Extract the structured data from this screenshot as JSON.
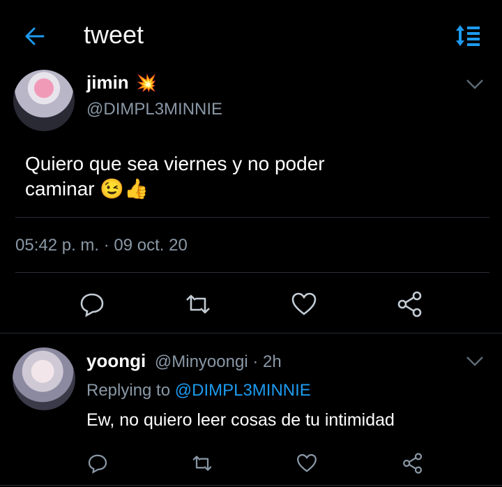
{
  "header": {
    "title": "tweet"
  },
  "tweet": {
    "name": "jimin",
    "name_emoji": "💥",
    "handle": "@DIMPL3MINNIE",
    "text_line1": "Quiero que sea viernes y no poder",
    "text_line2": "caminar",
    "text_emoji": "😉👍",
    "timestamp": "05:42 p. m. · 09 oct. 20"
  },
  "reply": {
    "name": "yoongi",
    "handle": "@Minyoongi",
    "time": "· 2h",
    "replying_prefix": "Replying to",
    "replying_handle": "@DIMPL3MINNIE",
    "text": "Ew, no quiero leer cosas de tu intimidad"
  },
  "colors": {
    "accent": "#1d9bf0",
    "muted": "#8a98a6",
    "background": "#000000"
  },
  "icons": [
    "back-arrow-icon",
    "sort-icon",
    "chevron-down-icon",
    "reply-icon",
    "retweet-icon",
    "like-icon",
    "share-icon"
  ]
}
